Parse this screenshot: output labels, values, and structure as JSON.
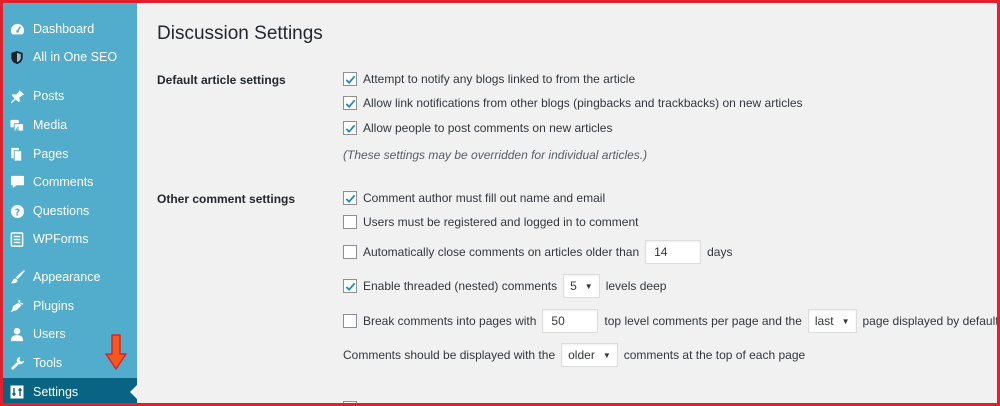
{
  "sidebar": {
    "items": [
      {
        "label": "Dashboard",
        "icon": "dashboard-icon"
      },
      {
        "label": "All in One SEO",
        "icon": "shield-icon"
      },
      {
        "label": "Posts",
        "icon": "pushpin-icon"
      },
      {
        "label": "Media",
        "icon": "media-icon"
      },
      {
        "label": "Pages",
        "icon": "pages-icon"
      },
      {
        "label": "Comments",
        "icon": "comment-bubble-icon"
      },
      {
        "label": "Questions",
        "icon": "question-icon"
      },
      {
        "label": "WPForms",
        "icon": "forms-icon"
      },
      {
        "label": "Appearance",
        "icon": "paintbrush-icon"
      },
      {
        "label": "Plugins",
        "icon": "plug-icon"
      },
      {
        "label": "Users",
        "icon": "user-icon"
      },
      {
        "label": "Tools",
        "icon": "wrench-icon"
      },
      {
        "label": "Settings",
        "icon": "settings-icon",
        "active": true
      }
    ]
  },
  "page": {
    "title": "Discussion Settings"
  },
  "default_article": {
    "label": "Default article settings",
    "options": [
      {
        "text": "Attempt to notify any blogs linked to from the article",
        "checked": true
      },
      {
        "text": "Allow link notifications from other blogs (pingbacks and trackbacks) on new articles",
        "checked": true
      },
      {
        "text": "Allow people to post comments on new articles",
        "checked": true
      }
    ],
    "note": "(These settings may be overridden for individual articles.)"
  },
  "other_comment": {
    "label": "Other comment settings",
    "author_fill": {
      "text": "Comment author must fill out name and email",
      "checked": true
    },
    "registered": {
      "text": "Users must be registered and logged in to comment",
      "checked": false
    },
    "auto_close": {
      "text_before": "Automatically close comments on articles older than",
      "value": "14",
      "text_after": "days",
      "checked": false
    },
    "threaded": {
      "text_before": "Enable threaded (nested) comments",
      "value": "5",
      "text_after": "levels deep",
      "checked": true
    },
    "paged": {
      "text_before": "Break comments into pages with",
      "value": "50",
      "text_middle": "top level comments per page and the",
      "select_value": "last",
      "text_after": "page displayed by default",
      "checked": false
    },
    "order": {
      "text_before": "Comments should be displayed with the",
      "select_value": "older",
      "text_after": "comments at the top of each page"
    }
  },
  "colors": {
    "sidebar": "#52accc",
    "active": "#096484",
    "border": "#e0202a",
    "arrow": "#f25a1d"
  }
}
